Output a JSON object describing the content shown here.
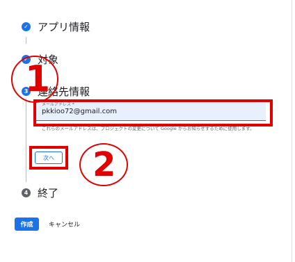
{
  "steps": [
    {
      "label": "アプリ情報",
      "state": "done",
      "icon": "check-icon",
      "icon_text": "✓"
    },
    {
      "label": "対象",
      "state": "done",
      "icon": "check-icon",
      "icon_text": "✓"
    },
    {
      "label": "連絡先情報",
      "state": "active",
      "icon": "step-number-icon",
      "icon_text": "3"
    },
    {
      "label": "終了",
      "state": "pending",
      "icon": "step-number-icon",
      "icon_text": "4"
    }
  ],
  "contact": {
    "email_caption": "メールアドレス *",
    "email_value": "pkkioo72@gmail.com",
    "helper_text": "これらのメールアドレスは、プロジェクトの変更について Google からお知らせするために使用します。",
    "next_label": "次へ"
  },
  "annotations": {
    "circle_1": "1",
    "circle_2": "2",
    "highlight_color": "#e10000"
  },
  "actions": {
    "create_label": "作成",
    "cancel_label": "キャンセル"
  },
  "colors": {
    "accent": "#1a73e8",
    "pending": "#5f6368"
  }
}
